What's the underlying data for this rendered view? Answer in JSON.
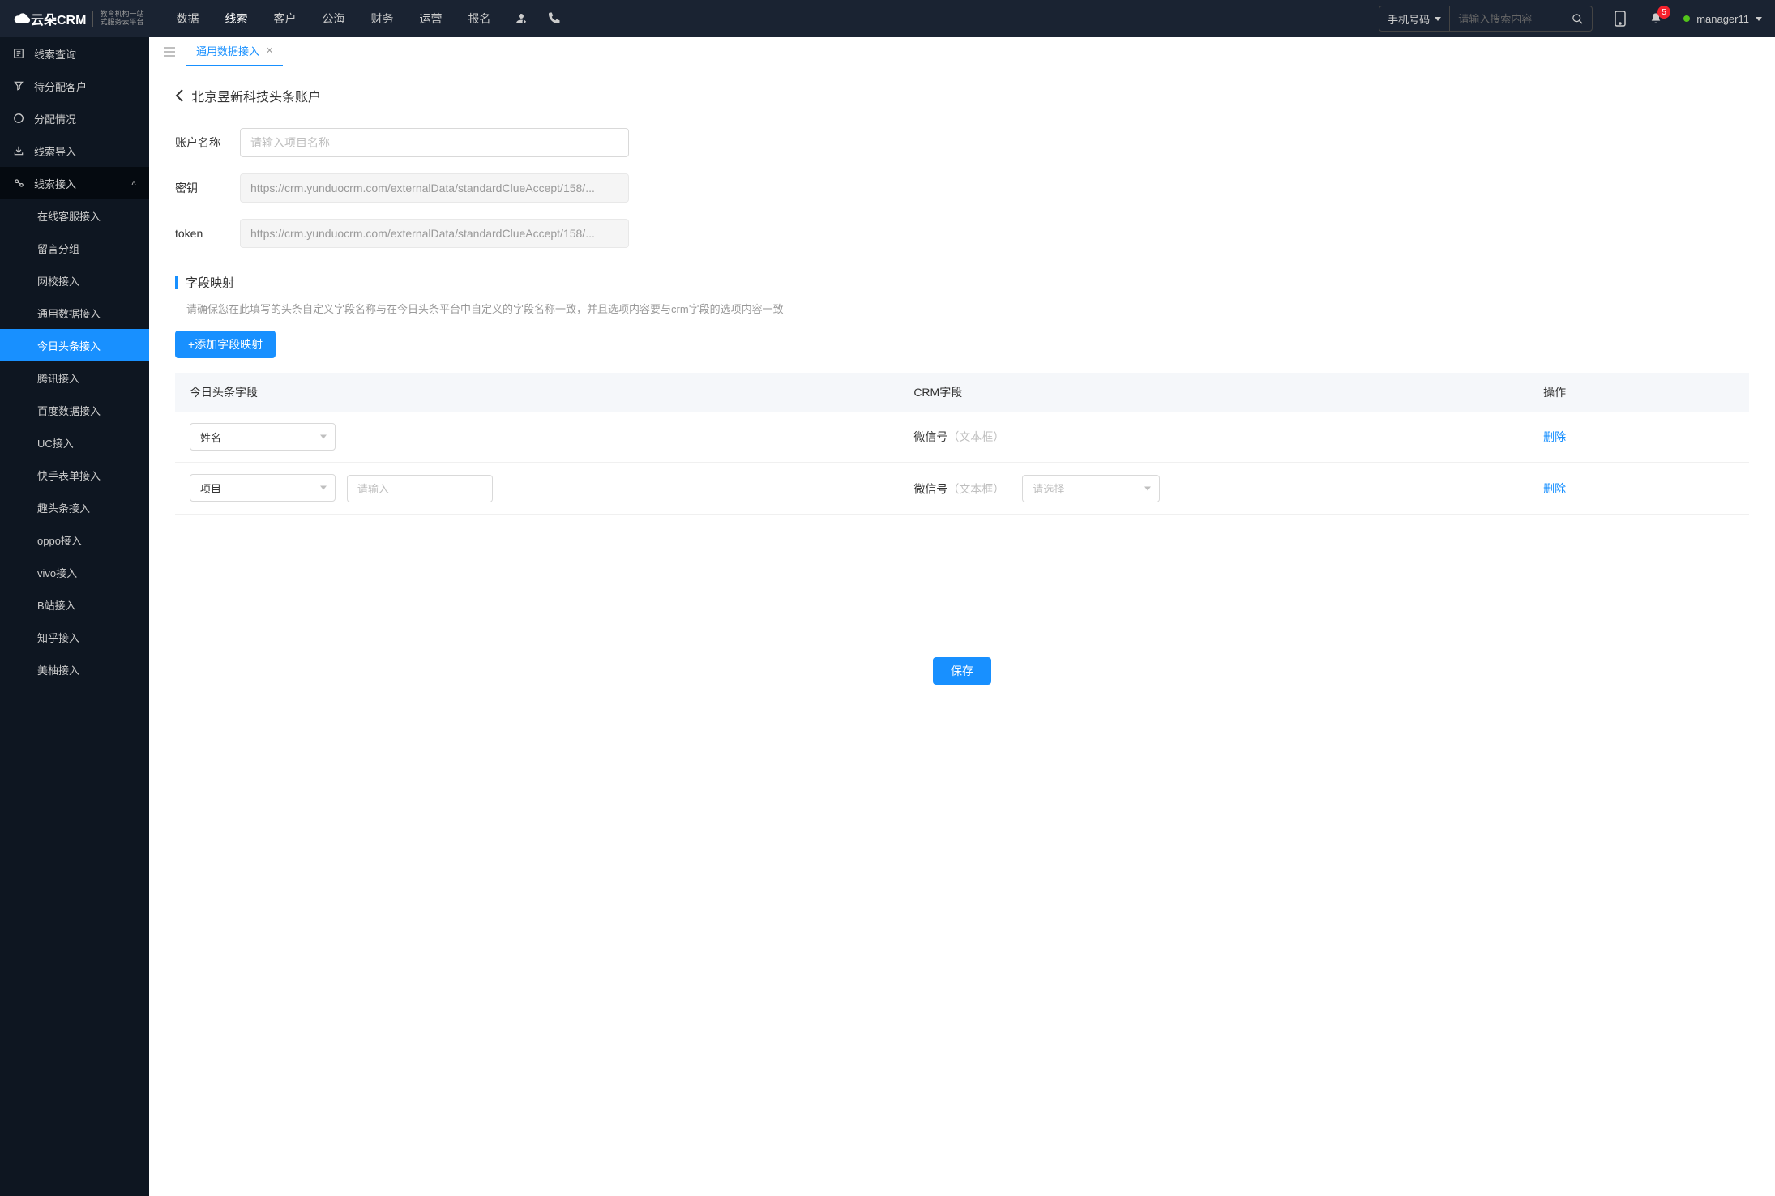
{
  "header": {
    "logo_text": "云朵CRM",
    "logo_sub1": "教育机构一站",
    "logo_sub2": "式服务云平台",
    "nav": [
      "数据",
      "线索",
      "客户",
      "公海",
      "财务",
      "运营",
      "报名"
    ],
    "nav_active": "线索",
    "search_mode": "手机号码",
    "search_placeholder": "请输入搜索内容",
    "badge_count": "5",
    "username": "manager11"
  },
  "sidebar": {
    "items": [
      {
        "label": "线索查询"
      },
      {
        "label": "待分配客户"
      },
      {
        "label": "分配情况"
      },
      {
        "label": "线索导入"
      },
      {
        "label": "线索接入",
        "expanded": true
      }
    ],
    "sub_items": [
      "在线客服接入",
      "留言分组",
      "网校接入",
      "通用数据接入",
      "今日头条接入",
      "腾讯接入",
      "百度数据接入",
      "UC接入",
      "快手表单接入",
      "趣头条接入",
      "oppo接入",
      "vivo接入",
      "B站接入",
      "知乎接入",
      "美柚接入"
    ],
    "active_sub": "今日头条接入"
  },
  "tabs": {
    "current": "通用数据接入"
  },
  "page": {
    "title": "北京昱新科技头条账户",
    "form": {
      "name_label": "账户名称",
      "name_placeholder": "请输入项目名称",
      "key_label": "密钥",
      "key_value": "https://crm.yunduocrm.com/externalData/standardClueAccept/158/...",
      "token_label": "token",
      "token_value": "https://crm.yunduocrm.com/externalData/standardClueAccept/158/..."
    },
    "section": {
      "title": "字段映射",
      "hint": "请确保您在此填写的头条自定义字段名称与在今日头条平台中自定义的字段名称一致，并且选项内容要与crm字段的选项内容一致",
      "add_btn": "+添加字段映射"
    },
    "table": {
      "col1": "今日头条字段",
      "col2": "CRM字段",
      "col3": "操作",
      "rows": [
        {
          "tt_select": "姓名",
          "crm_label": "微信号",
          "crm_type": "（文本框）",
          "action": "删除"
        },
        {
          "tt_select": "项目",
          "input_placeholder": "请输入",
          "crm_label": "微信号",
          "crm_type": "（文本框）",
          "select_placeholder": "请选择",
          "action": "删除"
        }
      ]
    },
    "save_btn": "保存"
  }
}
